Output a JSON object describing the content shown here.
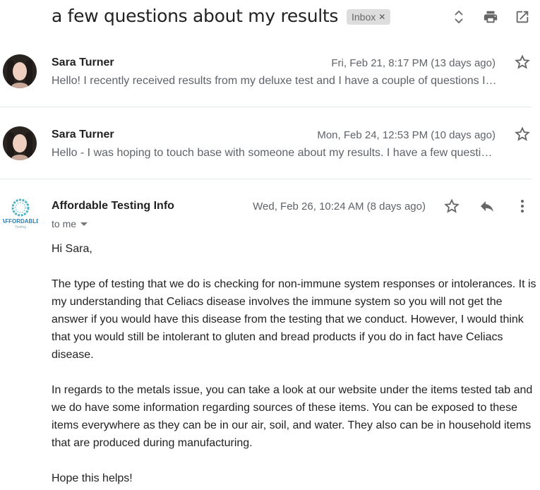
{
  "thread": {
    "subject": "a few questions about my results",
    "label": "Inbox",
    "label_remove_icon": "close-icon",
    "toolbar_icons": [
      "expand-collapse-icon",
      "print-icon",
      "open-in-new-window-icon"
    ]
  },
  "messages": [
    {
      "sender": "Sara Turner",
      "date": "Fri, Feb 21, 8:17 PM (13 days ago)",
      "snippet": "Hello! I recently received results from my deluxe test and I have a couple of questions I…",
      "starred": false
    },
    {
      "sender": "Sara Turner",
      "date": "Mon, Feb 24, 12:53 PM (10 days ago)",
      "snippet": "Hello - I was hoping to touch base with someone about my results. I have a few questi…",
      "starred": false
    }
  ],
  "open_message": {
    "sender": "Affordable Testing Info",
    "logo_text": "AFFORDABLE",
    "logo_subtext": "Testing",
    "recipient": "to me",
    "date": "Wed, Feb 26, 10:24 AM (8 days ago)",
    "starred": false,
    "greeting": "Hi Sara,",
    "paragraphs": [
      "The type of testing that we do is checking for non-immune system responses or intolerances.  It is my understanding that Celiacs disease involves the immune system so you will not get the answer if you would have this disease from the testing that we conduct.  However, I would think that you would still be intolerant to gluten and bread products if you do in fact have Celiacs disease.",
      "In regards to the metals issue, you can take a look at our website under the items tested tab and we do have some information regarding sources of these items.  You can be exposed to these items everywhere as they can be in our air, soil, and water.  They also can be in household items that are produced during manufacturing.",
      "Hope this helps!"
    ]
  },
  "colors": {
    "text_primary": "#222222",
    "text_secondary": "#5f6368",
    "chip_bg": "#dddddd",
    "divider": "#e6ecec",
    "icon": "#757575",
    "logo_teal": "#3aa7b8"
  }
}
